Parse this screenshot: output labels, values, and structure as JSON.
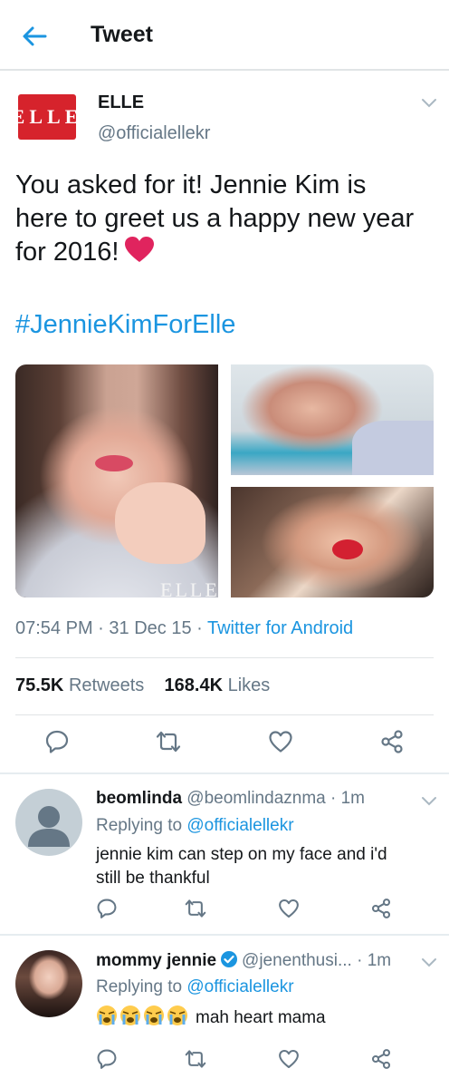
{
  "header": {
    "title": "Tweet",
    "back_icon": "arrow-left-icon"
  },
  "tweet": {
    "author_name": "ELLE",
    "author_handle": "@officialellekr",
    "avatar_text": "ELLE",
    "text_line1": "You asked for it! Jennie Kim is",
    "text_line2": "here to greet us a happy new year",
    "text_line3": "for 2016!",
    "hashtag": "#JennieKimForElle",
    "photo_watermark": "ELLE",
    "time": "07:54 PM",
    "date": "31 Dec 15",
    "source": "Twitter for Android",
    "retweets_count": "75.5K",
    "retweets_label": "Retweets",
    "likes_count": "168.4K",
    "likes_label": "Likes"
  },
  "replies": [
    {
      "name": "beomlinda",
      "handle": "@beomlindaznma",
      "time": "1m",
      "replying_label": "Replying to",
      "replying_handle": "@officialellekr",
      "text_line1": "jennie kim can step on my face and i'd",
      "text_line2": "still be thankful"
    },
    {
      "name": "mommy jennie",
      "handle": "@jenenthusi...",
      "time": "1m",
      "replying_label": "Replying to",
      "replying_handle": "@officialellekr",
      "text": "mah heart mama"
    }
  ],
  "colors": {
    "accent": "#1b95e0",
    "text_primary": "#14171a",
    "text_secondary": "#657786",
    "elle_red": "#d6232c",
    "heart": "#e0245e"
  }
}
